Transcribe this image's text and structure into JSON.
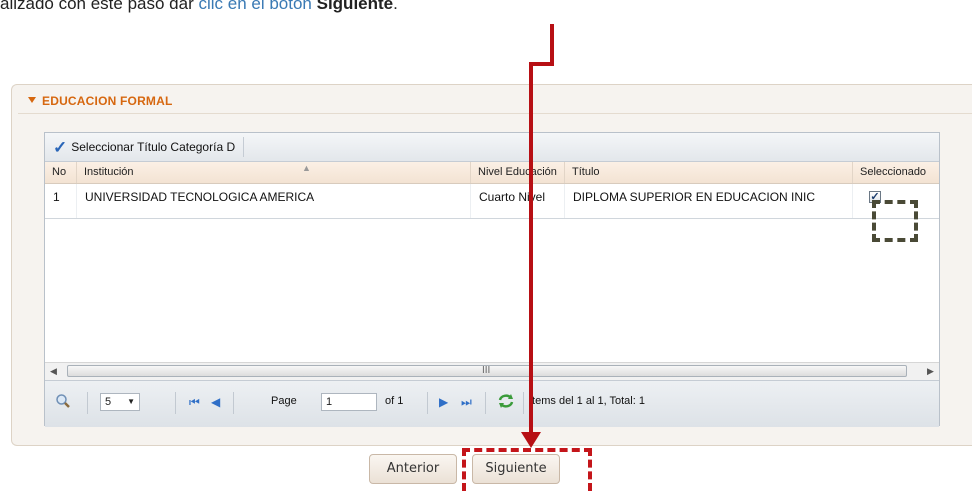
{
  "intro": {
    "prefix": "alizado con este paso dar ",
    "link_text": "clic en el botón",
    "bold_text": "Siguiente",
    "suffix": "."
  },
  "panel": {
    "title": "EDUCACION FORMAL"
  },
  "grid": {
    "toolbar_button": "Seleccionar Título Categoría D",
    "columns": [
      "No",
      "Institución",
      "Nivel Educación",
      "Título",
      "Seleccionado"
    ],
    "rows": [
      {
        "no": "1",
        "institucion": "UNIVERSIDAD TECNOLOGICA AMERICA",
        "nivel": "Cuarto Nivel",
        "titulo": "DIPLOMA SUPERIOR EN EDUCACION INIC",
        "seleccionado": true
      }
    ],
    "scroll_grip": "III"
  },
  "pager": {
    "page_size": "5",
    "page_label": "Page",
    "page_value": "1",
    "of_label": "of 1",
    "items_text": "Items del 1 al 1, Total: 1"
  },
  "buttons": {
    "prev": "Anterior",
    "next": "Siguiente"
  },
  "colors": {
    "accent_orange": "#d6670f",
    "annotation_red": "#b70f14",
    "link_blue": "#3a7ab4"
  }
}
